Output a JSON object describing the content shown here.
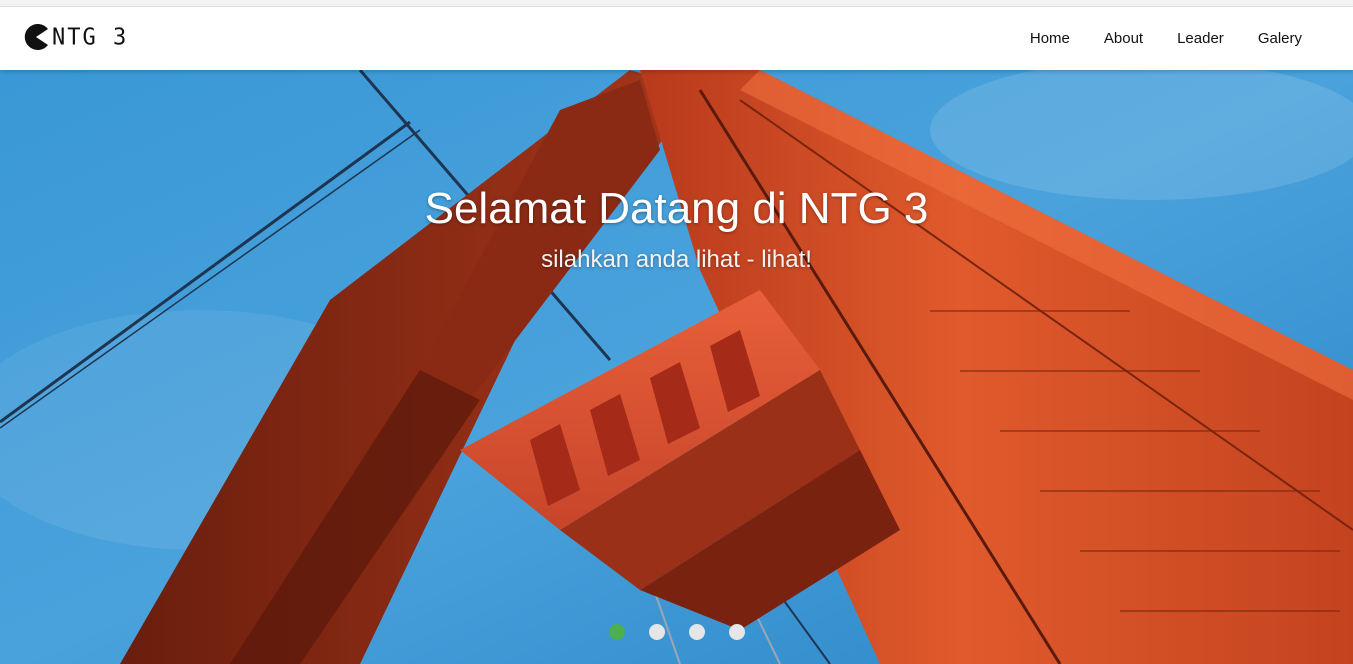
{
  "brand": {
    "text": "NTG 3",
    "icon": "pacman-icon"
  },
  "nav": {
    "items": [
      {
        "label": "Home"
      },
      {
        "label": "About"
      },
      {
        "label": "Leader"
      },
      {
        "label": "Galery"
      }
    ]
  },
  "hero": {
    "title": "Selamat Datang di NTG 3",
    "subtitle": "silahkan anda lihat - lihat!",
    "image": "golden-gate-bridge-tower-photo"
  },
  "slider": {
    "slides": 4,
    "active_index": 0,
    "active_color": "#4caf50",
    "inactive_color": "#e6e6e6"
  }
}
